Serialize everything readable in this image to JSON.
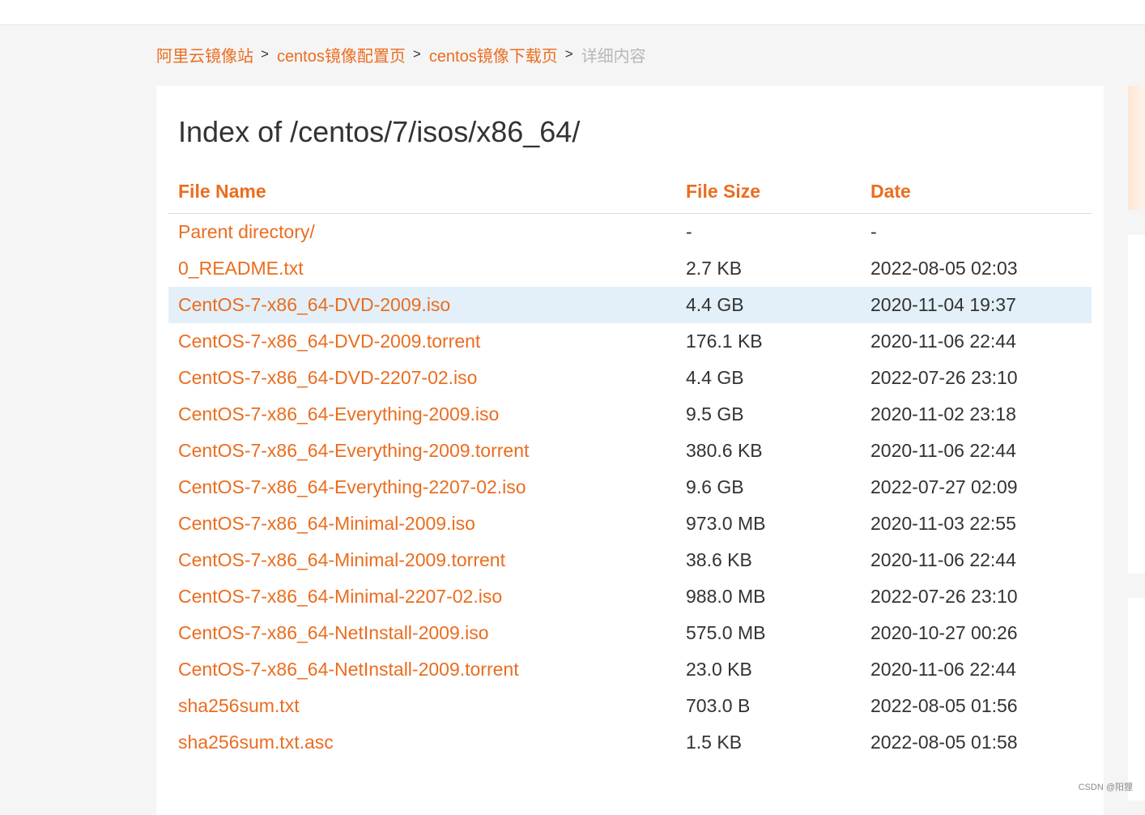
{
  "breadcrumb": {
    "items": [
      "阿里云镜像站",
      "centos镜像配置页",
      "centos镜像下载页"
    ],
    "separator": ">",
    "current": "详细内容"
  },
  "page": {
    "title": "Index of /centos/7/isos/x86_64/"
  },
  "table": {
    "headers": {
      "name": "File Name",
      "size": "File Size",
      "date": "Date"
    },
    "rows": [
      {
        "name": "Parent directory/",
        "size": "-",
        "date": "-"
      },
      {
        "name": "0_README.txt",
        "size": "2.7 KB",
        "date": "2022-08-05 02:03"
      },
      {
        "name": "CentOS-7-x86_64-DVD-2009.iso",
        "size": "4.4 GB",
        "date": "2020-11-04 19:37"
      },
      {
        "name": "CentOS-7-x86_64-DVD-2009.torrent",
        "size": "176.1 KB",
        "date": "2020-11-06 22:44"
      },
      {
        "name": "CentOS-7-x86_64-DVD-2207-02.iso",
        "size": "4.4 GB",
        "date": "2022-07-26 23:10"
      },
      {
        "name": "CentOS-7-x86_64-Everything-2009.iso",
        "size": "9.5 GB",
        "date": "2020-11-02 23:18"
      },
      {
        "name": "CentOS-7-x86_64-Everything-2009.torrent",
        "size": "380.6 KB",
        "date": "2020-11-06 22:44"
      },
      {
        "name": "CentOS-7-x86_64-Everything-2207-02.iso",
        "size": "9.6 GB",
        "date": "2022-07-27 02:09"
      },
      {
        "name": "CentOS-7-x86_64-Minimal-2009.iso",
        "size": "973.0 MB",
        "date": "2020-11-03 22:55"
      },
      {
        "name": "CentOS-7-x86_64-Minimal-2009.torrent",
        "size": "38.6 KB",
        "date": "2020-11-06 22:44"
      },
      {
        "name": "CentOS-7-x86_64-Minimal-2207-02.iso",
        "size": "988.0 MB",
        "date": "2022-07-26 23:10"
      },
      {
        "name": "CentOS-7-x86_64-NetInstall-2009.iso",
        "size": "575.0 MB",
        "date": "2020-10-27 00:26"
      },
      {
        "name": "CentOS-7-x86_64-NetInstall-2009.torrent",
        "size": "23.0 KB",
        "date": "2020-11-06 22:44"
      },
      {
        "name": "sha256sum.txt",
        "size": "703.0 B",
        "date": "2022-08-05 01:56"
      },
      {
        "name": "sha256sum.txt.asc",
        "size": "1.5 KB",
        "date": "2022-08-05 01:58"
      }
    ]
  },
  "watermark": "CSDN @阳狸",
  "colors": {
    "accent": "#ea6d1f",
    "row_highlight": "#e3f0f9",
    "text": "#333333",
    "muted": "#b8b8b8",
    "background": "#f5f5f5"
  }
}
